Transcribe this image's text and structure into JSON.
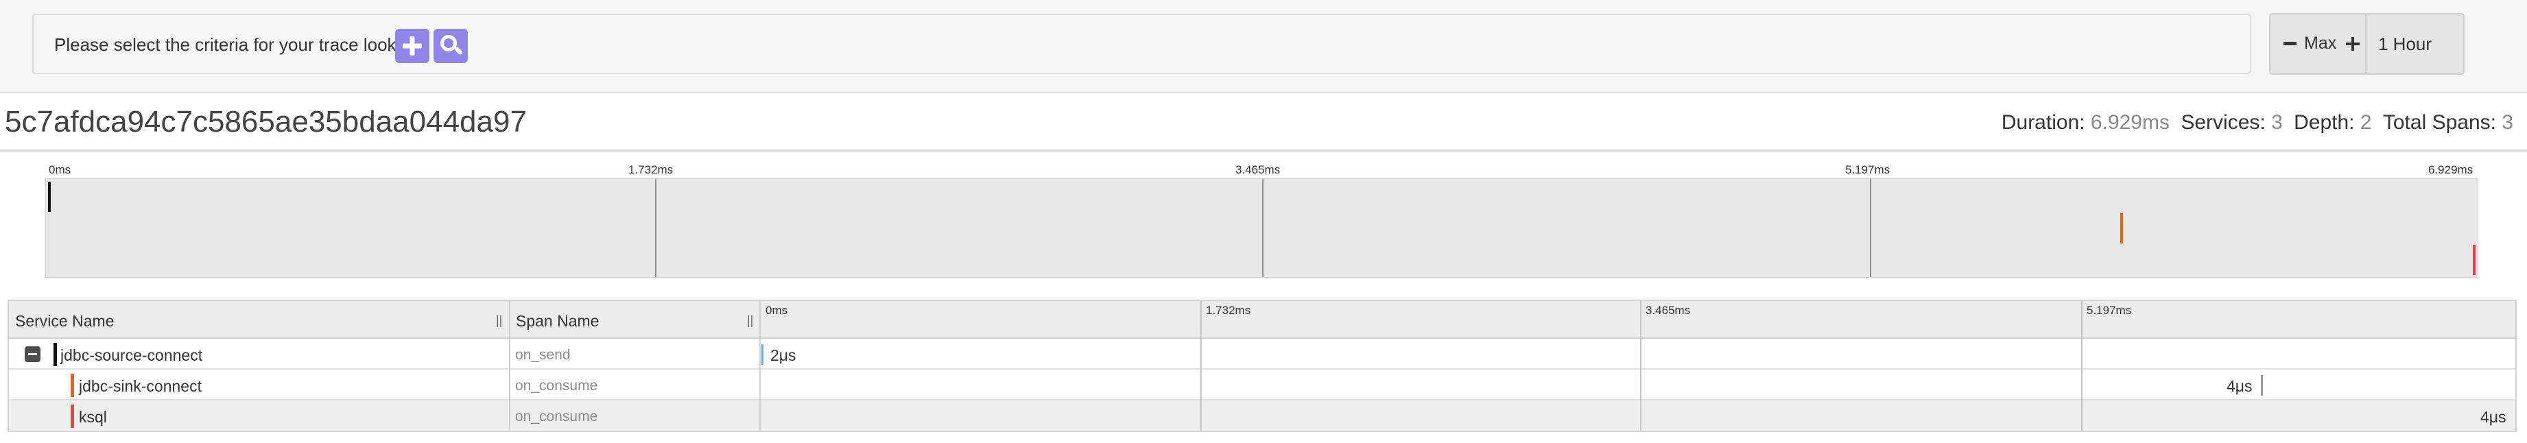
{
  "search": {
    "prompt": "Please select the criteria for your trace lookup.",
    "add_icon": "plus-icon",
    "search_icon": "search-icon",
    "accent_color": "#8f86e8"
  },
  "lookback": {
    "decrease_icon": "minus-icon",
    "limit_label": "Max",
    "increase_icon": "plus-icon",
    "range_label": "1 Hour"
  },
  "trace": {
    "id": "5c7afdca94c7c5865ae35bdaa044da97",
    "duration_label": "Duration:",
    "duration_value": "6.929ms",
    "services_label": "Services:",
    "services_value": "3",
    "depth_label": "Depth:",
    "depth_value": "2",
    "spans_label": "Total Spans:",
    "spans_value": "3"
  },
  "minimap": {
    "ticks": [
      "0ms",
      "1.732ms",
      "3.465ms",
      "5.197ms",
      "6.929ms"
    ]
  },
  "table": {
    "columns": {
      "service": "Service Name",
      "span": "Span Name",
      "resize_handle": "||"
    },
    "timeline_ticks": [
      "0ms",
      "1.732ms",
      "3.465ms",
      "5.197ms"
    ],
    "rows": [
      {
        "service": "jdbc-source-connect",
        "span": "on_send",
        "duration": "2μs",
        "color": "#111111",
        "collapse_icon": "minus-square-icon"
      },
      {
        "service": "jdbc-sink-connect",
        "span": "on_consume",
        "duration": "4μs",
        "color": "#e8601c"
      },
      {
        "service": "ksql",
        "span": "on_consume",
        "duration": "4μs",
        "color": "#e8404f"
      }
    ]
  }
}
